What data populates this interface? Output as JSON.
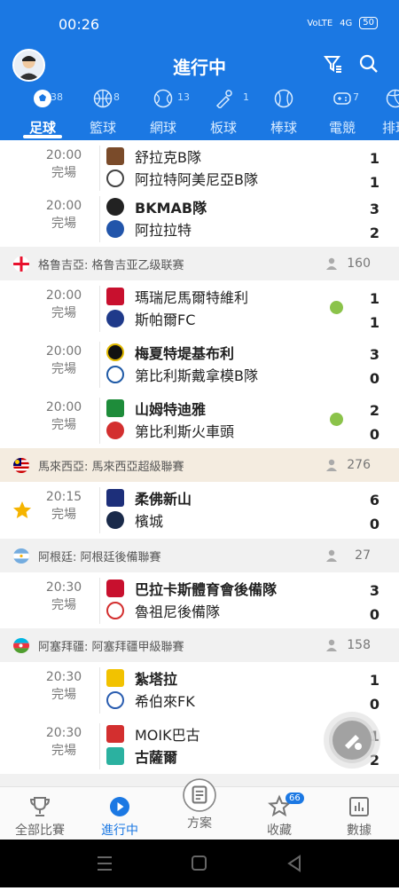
{
  "status_bar": {
    "time": "00:26",
    "net": "VoLTE",
    "signal": "4G",
    "battery": "50"
  },
  "header": {
    "title": "進行中"
  },
  "tabs": [
    {
      "label": "足球",
      "count": "38"
    },
    {
      "label": "籃球",
      "count": "8"
    },
    {
      "label": "網球",
      "count": "13"
    },
    {
      "label": "板球",
      "count": "1"
    },
    {
      "label": "棒球",
      "count": ""
    },
    {
      "label": "電競",
      "count": "7"
    },
    {
      "label": "排球",
      "count": ""
    }
  ],
  "matches_top": [
    {
      "time": "20:00",
      "status": "完場",
      "home": "舒拉克B隊",
      "away": "阿拉特阿美尼亞B隊",
      "home_score": "1",
      "away_score": "1"
    },
    {
      "time": "20:00",
      "status": "完場",
      "home": "BKMAB隊",
      "away": "阿拉拉特",
      "home_score": "3",
      "away_score": "2"
    }
  ],
  "leagues": [
    {
      "name": "格鲁吉亞: 格鲁吉亚乙级联赛",
      "followers": "160",
      "matches": [
        {
          "time": "20:00",
          "status": "完場",
          "home": "瑪瑞尼馬爾特維利",
          "away": "斯帕爾FC",
          "home_score": "1",
          "away_score": "1"
        },
        {
          "time": "20:00",
          "status": "完場",
          "home": "梅夏特堤基布利",
          "away": "第比利斯戴拿模B隊",
          "home_score": "3",
          "away_score": "0"
        },
        {
          "time": "20:00",
          "status": "完場",
          "home": "山姆特迪雅",
          "away": "第比利斯火車頭",
          "home_score": "2",
          "away_score": "0"
        }
      ]
    },
    {
      "name": "馬來西亞: 馬來西亞超級聯賽",
      "followers": "276",
      "matches": [
        {
          "time": "20:15",
          "status": "完場",
          "home": "柔佛新山",
          "away": "檳城",
          "home_score": "6",
          "away_score": "0"
        }
      ]
    },
    {
      "name": "阿根廷: 阿根廷後備聯賽",
      "followers": "27",
      "matches": [
        {
          "time": "20:30",
          "status": "完場",
          "home": "巴拉卡斯體育會後備隊",
          "away": "魯祖尼後備隊",
          "home_score": "3",
          "away_score": "0"
        }
      ]
    },
    {
      "name": "阿塞拜疆: 阿塞拜疆甲級聯賽",
      "followers": "158",
      "matches": [
        {
          "time": "20:30",
          "status": "完場",
          "home": "紮塔拉",
          "away": "希伯來FK",
          "home_score": "1",
          "away_score": "0"
        },
        {
          "time": "20:30",
          "status": "完場",
          "home": "MOIK巴古",
          "away": "古薩爾",
          "home_score": "1",
          "away_score": "2"
        }
      ]
    }
  ],
  "bottom_nav": [
    {
      "label": "全部比賽"
    },
    {
      "label": "進行中"
    },
    {
      "label": "方案"
    },
    {
      "label": "收藏",
      "badge": "66"
    },
    {
      "label": "數據"
    }
  ],
  "colors": {
    "primary": "#1b78e3",
    "league_bg": "#f1f1f1",
    "star": "#f5b400",
    "stats_green": "#8bc34a"
  }
}
